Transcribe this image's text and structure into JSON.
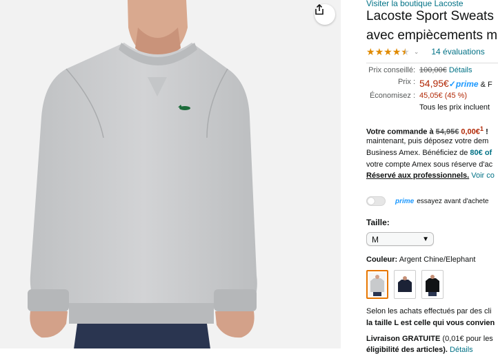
{
  "product": {
    "store_link": "Visiter la boutique Lacoste",
    "title_line1": "Lacoste Sport Sweats",
    "title_line2": "avec empièceme​nts m",
    "rating_count": "14 évaluations",
    "rating_value_stars": 4.5
  },
  "pricing": {
    "list_label": "Prix conseillé:",
    "list_price": "100,00€",
    "details_link": "Détails",
    "price_label": "Prix :",
    "price": "54,95€",
    "prime_check": "✓",
    "prime_word": "prime",
    "price_suffix": "& F",
    "savings_label": "Économisez :",
    "savings": "45,05€ (45 %)",
    "tax_note": "Tous les prix incluent"
  },
  "order": {
    "line1_prefix": "Votre commande à ",
    "line1_strike": "54,95€",
    "line1_new": " 0,00€",
    "line1_sup": "1",
    "line1_suffix": " !",
    "line2": "maintenant, puis déposez votre dem",
    "line3_prefix": "Business Amex. Bénéficiez de ",
    "line3_link": "80€ of",
    "line4": "votre compte Amex sous réserve d'ac",
    "line5_bold": "Réservé aux professionnels.",
    "line5_link": " Voir co"
  },
  "prime_try": {
    "prime": "prime",
    "text": "essayez avant d'achete"
  },
  "size": {
    "label": "Taille:",
    "selected": "M"
  },
  "color": {
    "label": "Couleur:",
    "selected": "Argent Chine/Elephant",
    "swatches": [
      "light-grey",
      "navy",
      "black"
    ]
  },
  "recommendation": {
    "line1": "Selon les achats effectués par des cli",
    "line2": "la taille L est celle qui vous convien"
  },
  "shipping": {
    "line1_bold": "Livraison GRATUITE",
    "line1_rest": " (0,01€ pour les",
    "line2_bold": "éligibilité des articles).",
    "line2_link": " Détails"
  },
  "colors": {
    "link": "#007185",
    "price_red": "#b12704",
    "star": "#e08a00",
    "prime_blue": "#1a98ff",
    "selected_border": "#e77600"
  }
}
